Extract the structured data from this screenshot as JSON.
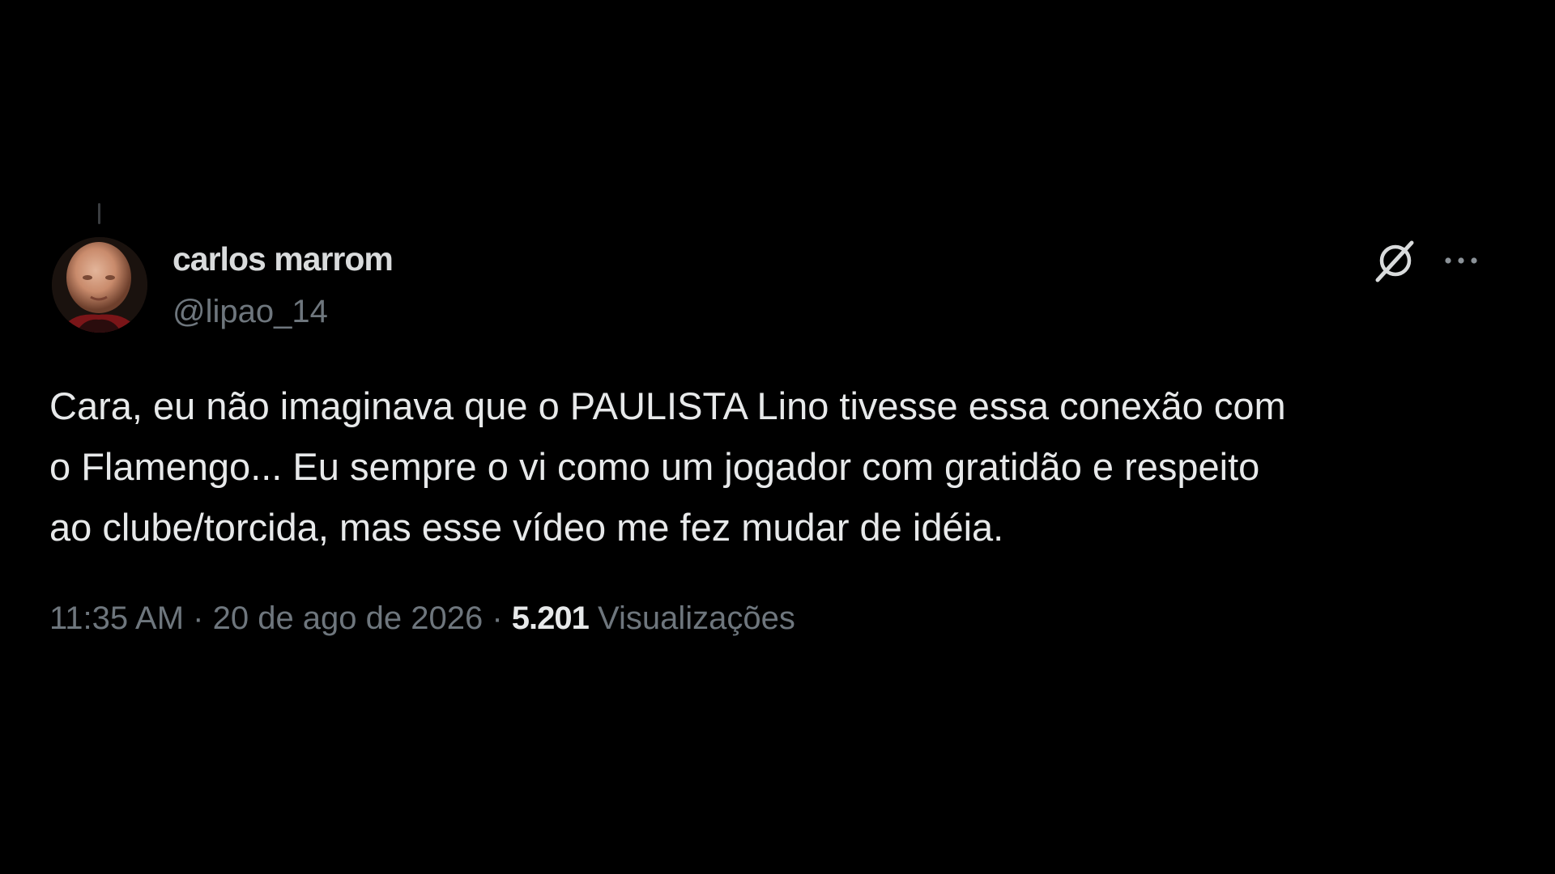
{
  "author": {
    "display_name": "carlos marrom",
    "handle": "@lipao_14",
    "avatar": "avatar"
  },
  "actions": {
    "grok_icon": "grok-slash-icon",
    "more_icon": "more-horizontal-icon"
  },
  "tweet": {
    "text_lines": [
      "Cara, eu não imaginava que o PAULISTA Lino tivesse essa conexão com",
      "o Flamengo... Eu sempre o vi como um jogador com gratidão e respeito",
      "ao clube/torcida, mas esse vídeo me fez mudar de idéia."
    ]
  },
  "meta": {
    "time": "11:35 AM",
    "separator": " · ",
    "date": "20 de ago de 2026",
    "views_count": "5.201",
    "views_label": "Visualizações"
  },
  "colors": {
    "background": "#000000",
    "primary_text": "#e7e9ea",
    "secondary_text": "#6e767d"
  }
}
